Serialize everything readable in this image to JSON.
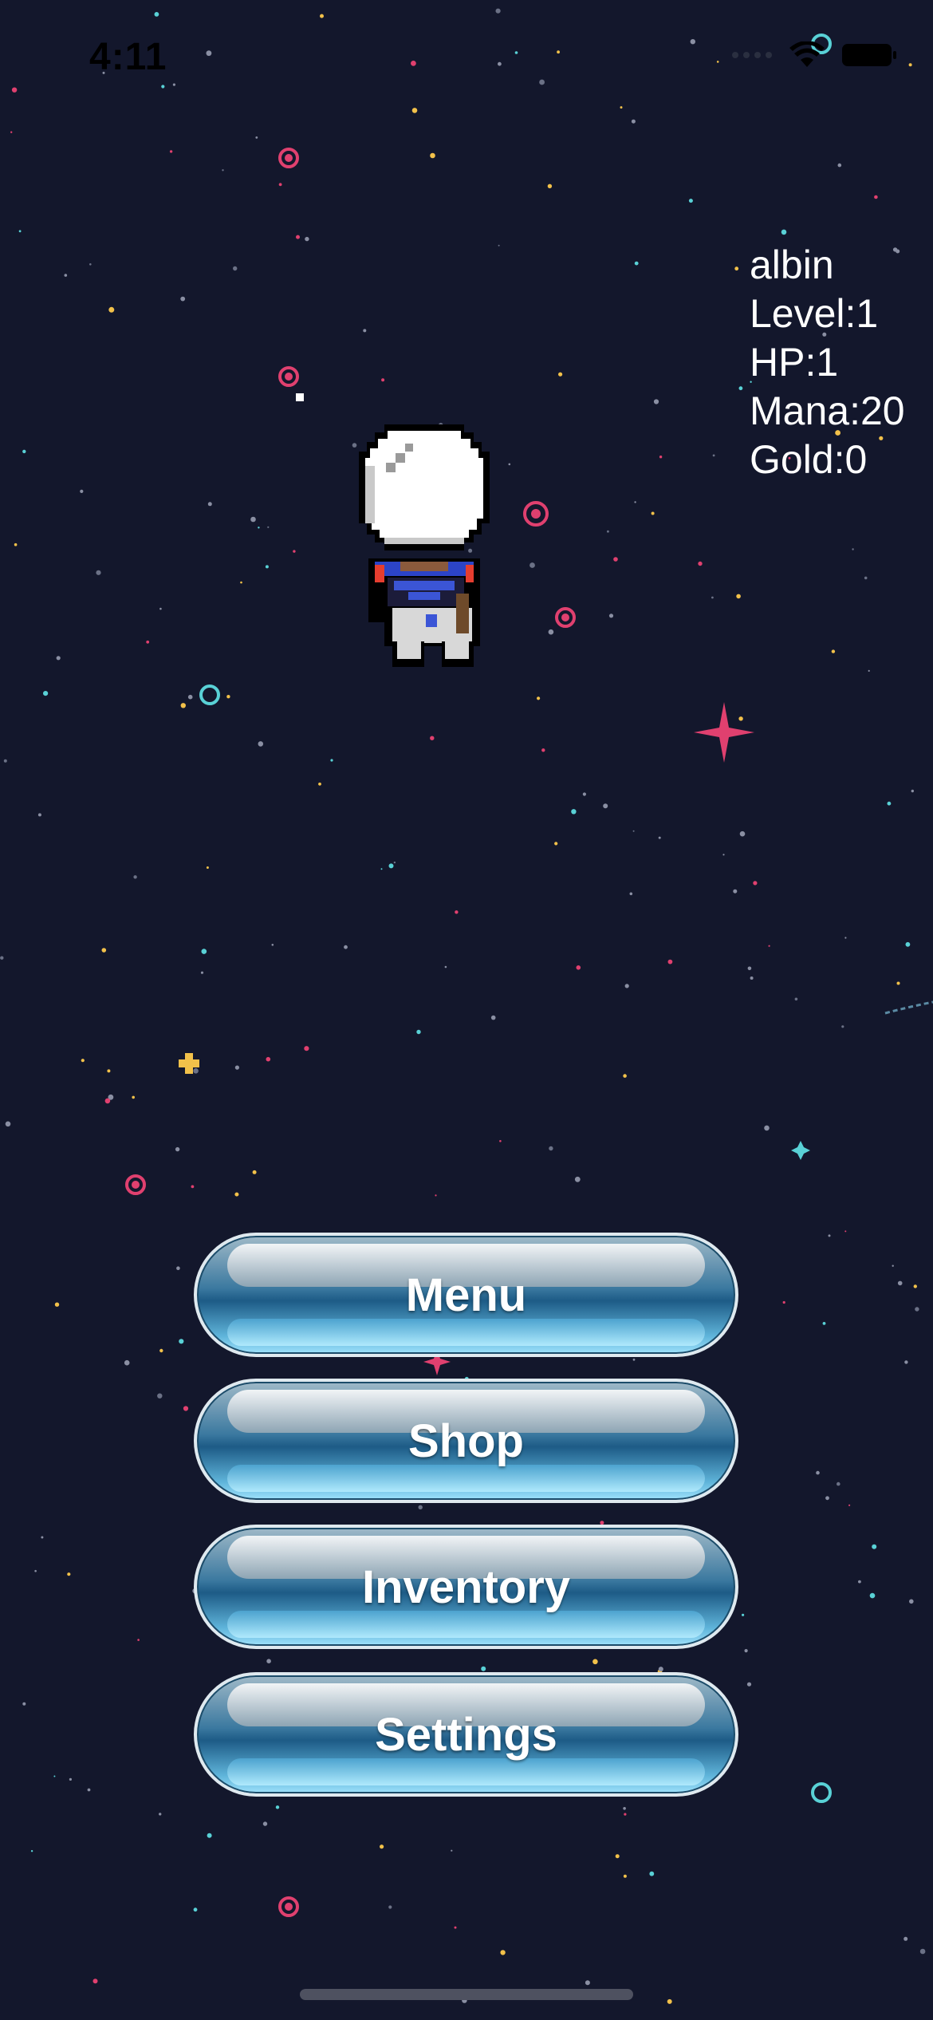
{
  "status_bar": {
    "time": "4:11"
  },
  "player": {
    "name": "albin",
    "level": "Level:1",
    "hp": "HP:1",
    "mana": "Mana:20",
    "gold": "Gold:0"
  },
  "buttons": {
    "menu": "Menu",
    "shop": "Shop",
    "inventory": "Inventory",
    "settings": "Settings"
  },
  "colors": {
    "background": "#13172c",
    "star_pink": "#e0406f",
    "star_cyan": "#59d1d6",
    "star_yellow": "#f2c14a"
  }
}
